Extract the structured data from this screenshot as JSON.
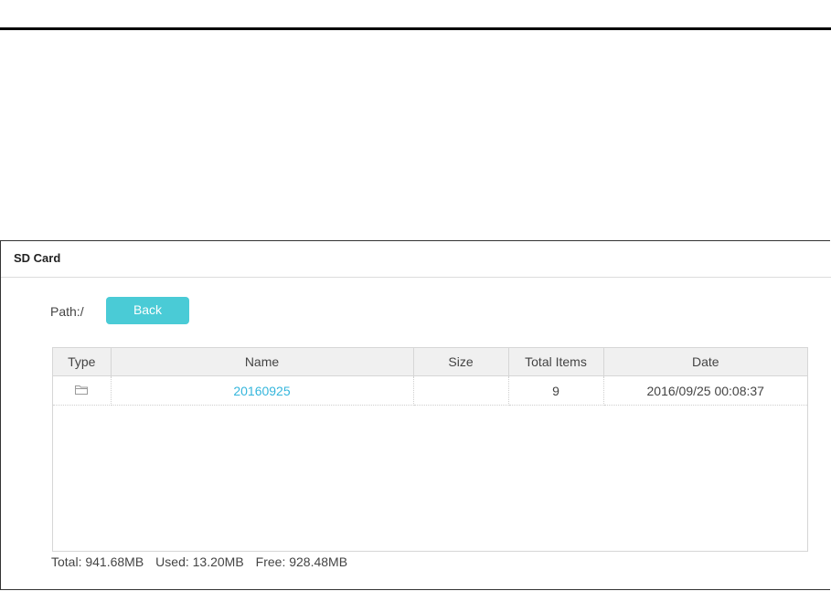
{
  "panel": {
    "title": "SD Card"
  },
  "path": {
    "label": "Path:/"
  },
  "toolbar": {
    "back_label": "Back"
  },
  "colors": {
    "accent": "#4acbd6",
    "link": "#35b6dc"
  },
  "table": {
    "columns": [
      "Type",
      "Name",
      "Size",
      "Total Items",
      "Date"
    ],
    "rows": [
      {
        "type_icon": "folder-icon",
        "name": "20160925",
        "size": "",
        "total_items": "9",
        "date": "2016/09/25 00:08:37"
      }
    ]
  },
  "storage": {
    "total": "Total: 941.68MB",
    "used": "Used: 13.20MB",
    "free": "Free: 928.48MB"
  }
}
